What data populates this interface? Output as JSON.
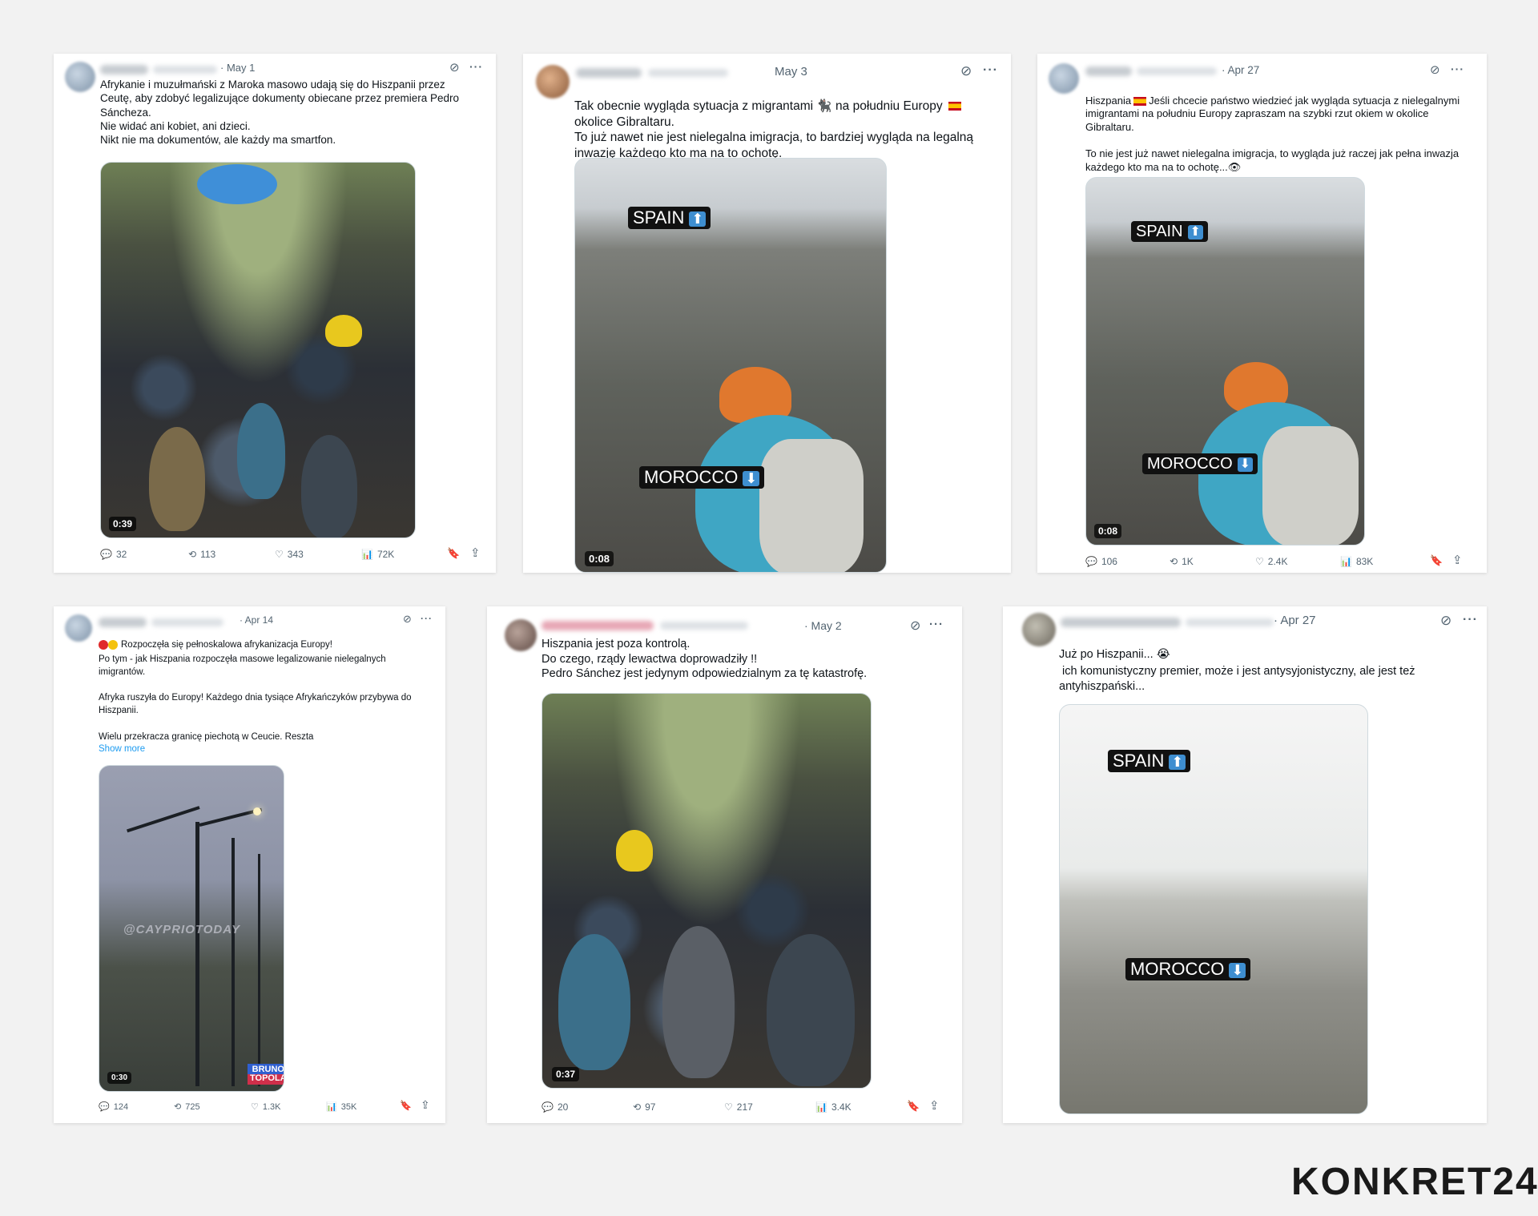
{
  "tweets": [
    {
      "date": "· May 1",
      "text": "Afrykanie i muzułmański z Maroka masowo udają się do Hiszpanii przez Ceutę, aby zdobyć legalizujące dokumenty obiecane przez premiera Pedro Sáncheza.\nNie widać ani kobiet, ani dzieci.\nNikt nie ma dokumentów, ale każdy ma smartfon.",
      "duration": "0:39",
      "stats": {
        "replies": "32",
        "reposts": "113",
        "likes": "343",
        "views": "72K"
      }
    },
    {
      "date": "May 3",
      "text_before_icons": "Tak obecnie wygląda sytuacja z migrantami ",
      "emoji_gorilla": "🐈‍⬛",
      "text_mid": " na południu Europy ",
      "text_after": "okolice Gibraltaru.\nTo już nawet nie jest nielegalna imigracja, to bardziej wygląda na legalną inwazję każdego kto ma na to ochotę.",
      "tag_top": "SPAIN",
      "tag_bottom": "MOROCCO",
      "arrow_up": "⬆",
      "arrow_down": "⬇",
      "duration": "0:08"
    },
    {
      "date": "· Apr 27",
      "text_prefix": "Hiszpania",
      "text": "Jeśli chcecie państwo wiedzieć jak wygląda sytuacja z nielegalnymi imigrantami na południu Europy zapraszam na szybki rzut okiem w okolice Gibraltaru.\n\nTo nie jest już nawet nielegalna imigracja, to wygląda już raczej jak pełna inwazja każdego kto ma na to ochotę...",
      "emoji_eye": "👁",
      "tag_top": "SPAIN",
      "tag_bottom": "MOROCCO",
      "duration": "0:08",
      "stats": {
        "replies": "106",
        "reposts": "1K",
        "likes": "2.4K",
        "views": "83K"
      }
    },
    {
      "date": "· Apr 14",
      "headline": "Rozpoczęła się pełnoskalowa afrykanizacja Europy!",
      "text": "Po tym - jak Hiszpania rozpoczęła masowe legalizowanie nielegalnych imigrantów.\n\nAfryka ruszyła do Europy! Każdego dnia tysiące Afrykańczyków przybywa do Hiszpanii.\n\nWielu przekracza granicę piechotą w Ceucie. Reszta",
      "show_more": "Show more",
      "watermark": "@CAYPRIOTODAY",
      "brand": "BRUNO\nTOPOLA",
      "duration": "0:30",
      "stats": {
        "replies": "124",
        "reposts": "725",
        "likes": "1.3K",
        "views": "35K"
      }
    },
    {
      "date": "· May 2",
      "text": "Hiszpania jest poza kontrolą.\nDo czego, rządy lewactwa doprowadziły !!\nPedro Sánchez jest jedynym odpowiedzialnym za tę katastrofę.",
      "duration": "0:37",
      "stats": {
        "replies": "20",
        "reposts": "97",
        "likes": "217",
        "views": "3.4K"
      }
    },
    {
      "date": "· Apr 27",
      "text_main": "Już po Hiszpanii... ",
      "emoji_cry": "😭",
      "text": "ich komunistyczny premier, może i jest antysyjonistyczny, ale jest też antyhiszpański...",
      "tag_top": "SPAIN",
      "tag_bottom": "MOROCCO"
    }
  ],
  "icons": {
    "reply": "💬",
    "repost": "⟲",
    "like": "♡",
    "views": "📊",
    "grok": "⊘",
    "more": "···",
    "bookmark": "🔖",
    "share": "⇪"
  },
  "colors": {
    "accent": "#1d9bf0",
    "muted": "#536471",
    "background": "#f2f2f2"
  },
  "brand_logo": "KONKRET24"
}
